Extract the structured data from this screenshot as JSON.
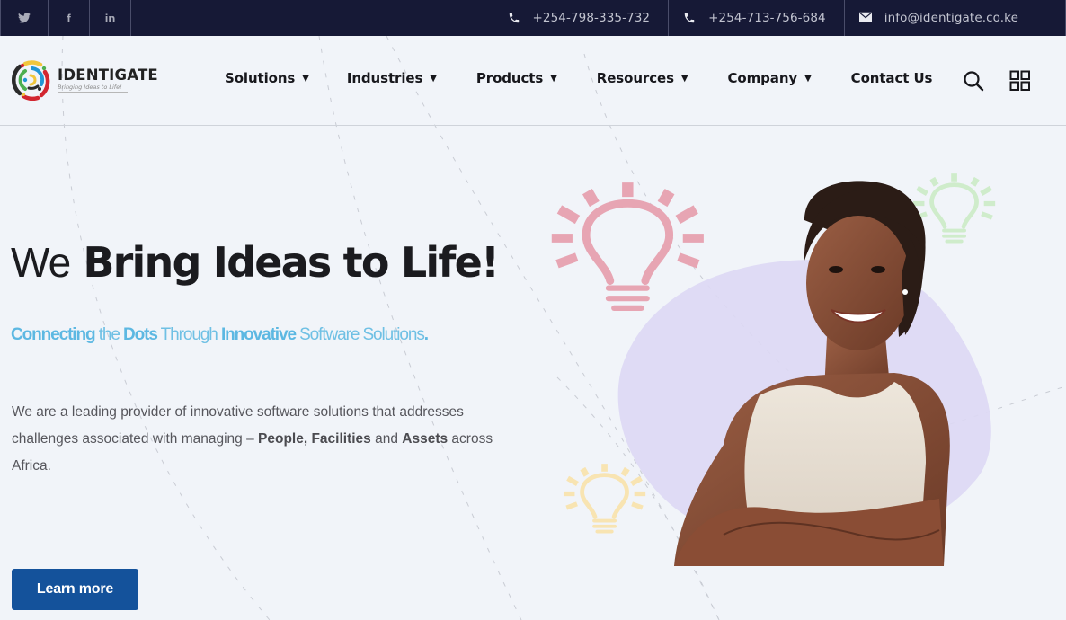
{
  "topbar": {
    "social": [
      {
        "icon": "twitter-icon",
        "glyph": "🐦"
      },
      {
        "icon": "facebook-icon",
        "glyph": "f"
      },
      {
        "icon": "linkedin-icon",
        "glyph": "in"
      }
    ],
    "contacts": [
      {
        "icon": "phone-icon",
        "text": "+254-798-335-732"
      },
      {
        "icon": "phone-icon",
        "text": "+254-713-756-684"
      },
      {
        "icon": "email-icon",
        "text": "info@identigate.co.ke"
      }
    ]
  },
  "header": {
    "logo": {
      "name": "IDENTIGATE",
      "tagline": "Bringing Ideas to Life!"
    },
    "nav": [
      {
        "label": "Solutions",
        "dropdown": true,
        "caret": "▼"
      },
      {
        "label": "Industries",
        "dropdown": true,
        "caret": "▼"
      },
      {
        "label": "Products",
        "dropdown": true,
        "caret": "▼"
      },
      {
        "label": "Resources",
        "dropdown": true,
        "caret": "▼"
      },
      {
        "label": "Company",
        "dropdown": true,
        "caret": "▼"
      },
      {
        "label": "Contact Us",
        "dropdown": false,
        "caret": ""
      }
    ]
  },
  "hero": {
    "title_light": "We",
    "title_bold": "Bring Ideas to Life!",
    "subtitle": {
      "w1": "Connecting",
      "w2": "the",
      "w3": "Dots",
      "w4": "Through",
      "w5": "Innovative",
      "w6": "Software Solutions",
      "w7": "."
    },
    "description": {
      "part1": "We are a leading provider of innovative software solutions that addresses challenges associated with managing – ",
      "bold1": "People, Facilities",
      "part2": " and ",
      "bold2": "Assets",
      "part3": " across Africa."
    },
    "cta_label": "Learn more"
  },
  "colors": {
    "topbar_bg": "#161936",
    "page_bg": "#f1f4f9",
    "accent_blue": "#14529b",
    "subtitle_blue": "#6fc0e4",
    "blob_lavender": "#ddd8f4",
    "bulb_pink": "#e7a5b3",
    "bulb_green": "#cfeccb",
    "bulb_blue": "#a4cde9",
    "bulb_yellow": "#f8e4b2"
  }
}
